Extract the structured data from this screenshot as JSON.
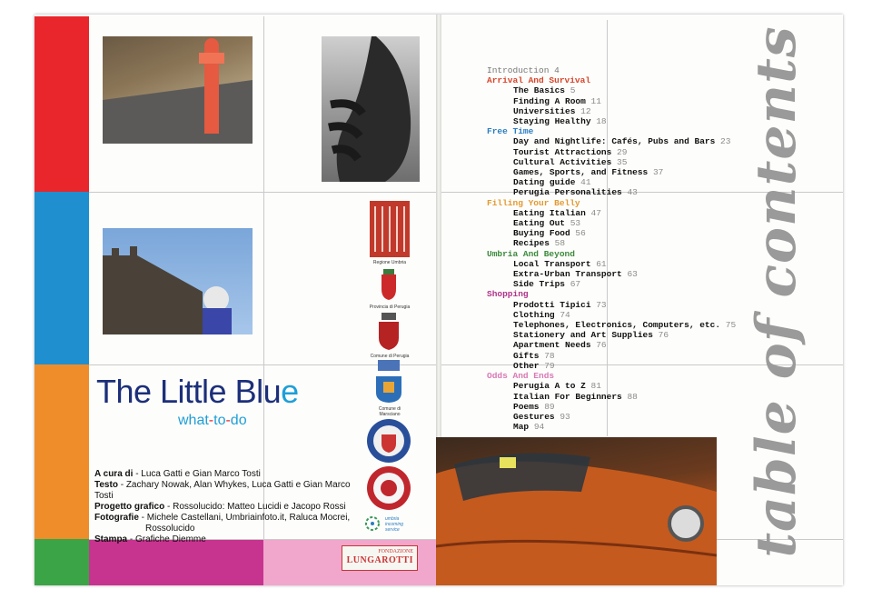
{
  "book": {
    "title_main": "The Little Blu",
    "title_accent": "e",
    "subtitle_a": "what",
    "subtitle_dash1": "-",
    "subtitle_b": "to",
    "subtitle_dash2": "-",
    "subtitle_c": "do"
  },
  "credits": [
    {
      "label": "A cura di",
      "text": " - Luca Gatti e Gian Marco Tosti"
    },
    {
      "label": "Testo",
      "text": " - Zachary Nowak, Alan Whykes, Luca Gatti e Gian Marco Tosti"
    },
    {
      "label": "Progetto grafico",
      "text": " - Rossolucido: Matteo Lucidi e Jacopo Rossi"
    },
    {
      "label": "Fotografie",
      "text": " - Michele Castellani, Umbriainfoto.it, Raluca Mocrei,"
    },
    {
      "label": "",
      "text": "Rossolucido"
    },
    {
      "label": "Stampa",
      "text": " - Grafiche Diemme"
    }
  ],
  "logos": {
    "regione": "Regione Umbria",
    "provincia": "Provincia di Perugia",
    "comune_perugia": "Comune di Perugia",
    "comune_marsciano_1": "Comune di",
    "comune_marsciano_2": "Marsciano",
    "fondazione_1": "FONDAZIONE",
    "fondazione_2": "LUNGAROTTI",
    "umbria_1": "umbria",
    "umbria_2": "incoming",
    "umbria_3": "service"
  },
  "colors": {
    "red": "#e8262c",
    "blue": "#1f8fd0",
    "orange": "#ee8d2a",
    "green": "#3aa447",
    "magenta": "#c7348f",
    "pink": "#f1a6cc",
    "title_blue": "#1c2f7a",
    "accent_cyan": "#1e9fd8",
    "sec_red": "#d7442a",
    "sec_blue": "#2a7dc2",
    "sec_orange": "#e39a30",
    "sec_green": "#3c8a3c",
    "sec_magenta": "#b0338a",
    "sec_pink": "#d979b6"
  },
  "toc": {
    "vertical_title": "table of contents",
    "intro": {
      "title": "Introduction",
      "page": "4"
    },
    "sections": [
      {
        "title": "Arrival And Survival",
        "items": [
          {
            "title": "The Basics",
            "page": "5"
          },
          {
            "title": "Finding A Room",
            "page": "11"
          },
          {
            "title": "Universities",
            "page": "12"
          },
          {
            "title": "Staying Healthy",
            "page": "18"
          }
        ]
      },
      {
        "title": "Free Time",
        "items": [
          {
            "title": "Day and Nightlife: Cafés, Pubs and Bars",
            "page": "23"
          },
          {
            "title": "Tourist Attractions",
            "page": "29"
          },
          {
            "title": "Cultural Activities",
            "page": "35"
          },
          {
            "title": "Games, Sports, and Fitness",
            "page": "37"
          },
          {
            "title": "Dating guide",
            "page": "41"
          },
          {
            "title": "Perugia Personalities",
            "page": "43"
          }
        ]
      },
      {
        "title": "Filling Your Belly",
        "items": [
          {
            "title": "Eating Italian",
            "page": "47"
          },
          {
            "title": "Eating Out",
            "page": "53"
          },
          {
            "title": "Buying Food",
            "page": "56"
          },
          {
            "title": "Recipes",
            "page": "58"
          }
        ]
      },
      {
        "title": "Umbria And Beyond",
        "items": [
          {
            "title": "Local Transport",
            "page": "61"
          },
          {
            "title": "Extra-Urban Transport",
            "page": "63"
          },
          {
            "title": "Side Trips",
            "page": "67"
          }
        ]
      },
      {
        "title": "Shopping",
        "items": [
          {
            "title": "Prodotti Tipici",
            "page": "73"
          },
          {
            "title": "Clothing",
            "page": "74"
          },
          {
            "title": "Telephones, Electronics, Computers, etc.",
            "page": "75"
          },
          {
            "title": "Stationery and Art Supplies",
            "page": "76"
          },
          {
            "title": "Apartment Needs",
            "page": "76"
          },
          {
            "title": "Gifts",
            "page": "78"
          },
          {
            "title": "Other",
            "page": "79"
          }
        ]
      },
      {
        "title": "Odds And Ends",
        "items": [
          {
            "title": "Perugia A to Z",
            "page": "81"
          },
          {
            "title": "Italian For Beginners",
            "page": "88"
          },
          {
            "title": "Poems",
            "page": "89"
          },
          {
            "title": "Gestures",
            "page": "93"
          },
          {
            "title": "Map",
            "page": "94"
          }
        ]
      }
    ]
  }
}
